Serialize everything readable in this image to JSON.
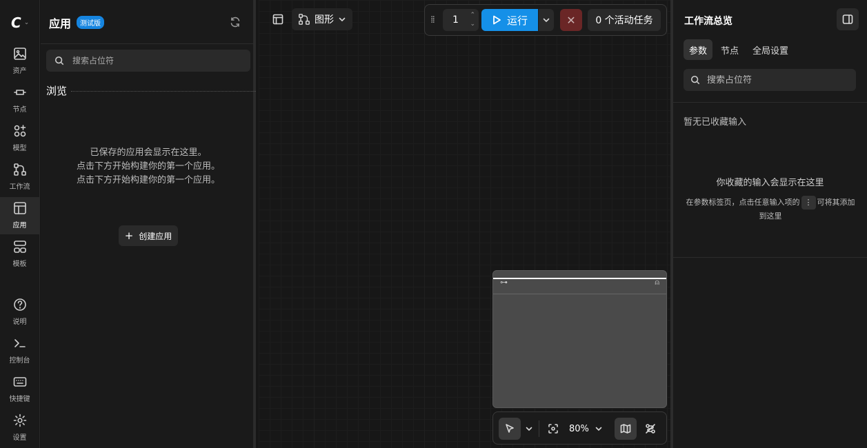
{
  "rail": {
    "logo": "C",
    "items": [
      {
        "label": "资产",
        "icon": "image-icon"
      },
      {
        "label": "节点",
        "icon": "node-icon"
      },
      {
        "label": "模型",
        "icon": "models-icon"
      },
      {
        "label": "工作流",
        "icon": "workflow-icon"
      },
      {
        "label": "应用",
        "icon": "app-layout-icon",
        "active": true
      },
      {
        "label": "模板",
        "icon": "templates-icon"
      },
      {
        "label": "说明",
        "icon": "help-icon"
      },
      {
        "label": "控制台",
        "icon": "terminal-icon"
      },
      {
        "label": "快捷键",
        "icon": "keyboard-icon"
      },
      {
        "label": "设置",
        "icon": "gear-icon"
      }
    ]
  },
  "apps_panel": {
    "title": "应用",
    "badge": "测试版",
    "search_placeholder": "搜索占位符",
    "browse_label": "浏览",
    "empty_lines": [
      "已保存的应用会显示在这里。",
      "点击下方开始构建你的第一个应用。",
      "点击下方开始构建你的第一个应用。"
    ],
    "create_button": "创建应用"
  },
  "canvas": {
    "view_mode": "图形",
    "batch_count": "1",
    "run_label": "运行",
    "active_jobs": "0 个活动任务",
    "zoom_level": "80%"
  },
  "right_panel": {
    "title": "工作流总览",
    "tabs": [
      "参数",
      "节点",
      "全局设置"
    ],
    "active_tab": 0,
    "search_placeholder": "搜索占位符",
    "no_favorites": "暂无已收藏输入",
    "favorites_title": "你收藏的输入会显示在这里",
    "favorites_hint_before": "在参数标签页，点击任意输入项的",
    "favorites_hint_after": "可将其添加到这里"
  },
  "colors": {
    "accent": "#1590e8",
    "cancel": "#6a2626",
    "badge": "#1685e0"
  }
}
